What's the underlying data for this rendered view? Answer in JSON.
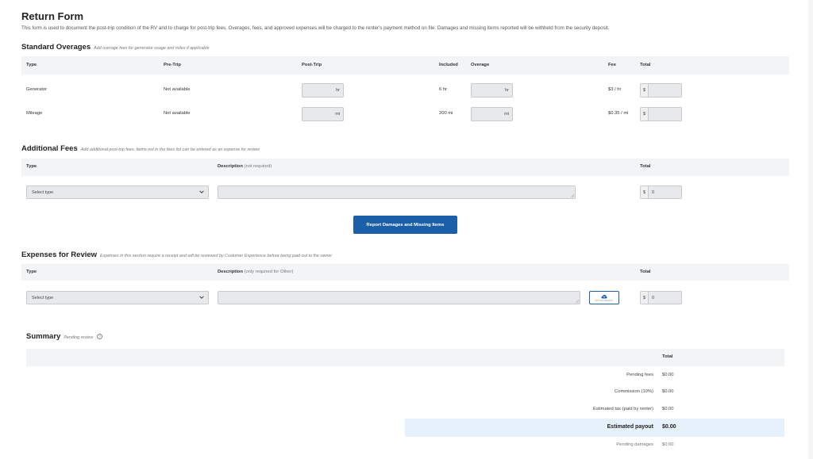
{
  "page": {
    "title": "Return Form",
    "intro": "This form is used to document the post-trip condition of the RV and to charge for post-trip fees. Overages, fees, and approved expenses will be charged to the renter's payment method on file. Damages and missing items reported will be withheld from the security deposit."
  },
  "standard_overages": {
    "title": "Standard Overages",
    "subtitle": "Add overage fees for generator usage and miles if applicable",
    "headers": {
      "type": "Type",
      "pre_trip": "Pre-Trip",
      "post_trip": "Post-Trip",
      "included": "Included",
      "overage": "Overage",
      "fee": "Fee",
      "total": "Total"
    },
    "rows": [
      {
        "type": "Generator",
        "pre_trip": "Not available",
        "post_trip_unit": "hr",
        "included": "6 hr",
        "overage_unit": "hr",
        "fee": "$3 / hr",
        "currency": "$",
        "total": ""
      },
      {
        "type": "Mileage",
        "pre_trip": "Not available",
        "post_trip_unit": "mi",
        "included": "200 mi",
        "overage_unit": "mi",
        "fee": "$0.35 / mi",
        "currency": "$",
        "total": ""
      }
    ]
  },
  "additional_fees": {
    "title": "Additional Fees",
    "subtitle": "Add additional post-trip fees. Items not in the fees list can be entered as an expense for review",
    "headers": {
      "type": "Type",
      "description": "Description",
      "description_note": "(not required)",
      "total": "Total"
    },
    "type_select": "Select type",
    "currency": "$",
    "total_value": "0"
  },
  "report_button": "Report Damages and Missing Items",
  "expenses": {
    "title": "Expenses for Review",
    "subtitle": "Expenses in this section require a receipt and will be reviewed by Customer Experience before being paid out to the owner",
    "headers": {
      "type": "Type",
      "description": "Description",
      "description_note": "(only required for Other)",
      "total": "Total"
    },
    "type_select": "Select type",
    "upload_label": "UPLOAD RECEIPT",
    "currency": "$",
    "total_value": "0"
  },
  "summary": {
    "title": "Summary",
    "subtitle": "Pending review",
    "help": "?",
    "total_header": "Total",
    "rows": [
      {
        "label": "Pending fees",
        "value": "$0.00"
      },
      {
        "label": "Commission (10%)",
        "value": "$0.00"
      },
      {
        "label": "Estimated tax (paid by renter)",
        "value": "$0.00"
      }
    ],
    "payout": {
      "label": "Estimated payout",
      "value": "$0.00"
    },
    "damages": {
      "label": "Pending damages",
      "value": "$0.00"
    }
  },
  "colors": {
    "accent": "#1a5fa8",
    "header_bg": "#f3f4f6",
    "payout_bg": "#e7f1fb",
    "input_bg": "#e8e9eb"
  },
  "icons": {
    "select": "chevron-down-icon",
    "upload": "cloud-upload-icon",
    "help": "help-circle-icon"
  }
}
